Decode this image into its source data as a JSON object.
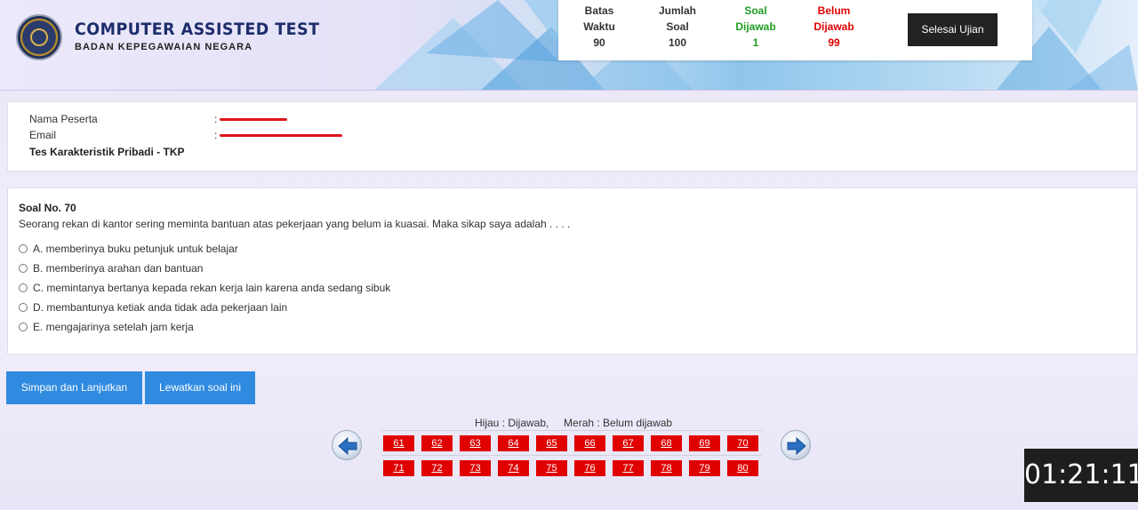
{
  "brand": {
    "title": "COMPUTER ASSISTED TEST",
    "subtitle": "BADAN KEPEGAWAIAN NEGARA"
  },
  "stats": {
    "batas_waktu": {
      "label1": "Batas",
      "label2": "Waktu",
      "value": "90"
    },
    "jumlah_soal": {
      "label1": "Jumlah",
      "label2": "Soal",
      "value": "100"
    },
    "soal_dijawab": {
      "label1": "Soal",
      "label2": "Dijawab",
      "value": "1"
    },
    "belum_dijawab": {
      "label1": "Belum",
      "label2": "Dijawab",
      "value": "99"
    }
  },
  "finish_button": "Selesai Ujian",
  "participant": {
    "name_label": "Nama Peserta",
    "email_label": "Email",
    "colon": ":",
    "test_name": "Tes Karakteristik Pribadi - TKP"
  },
  "question": {
    "number_label": "Soal No. 70",
    "text": "Seorang rekan di kantor sering meminta bantuan atas pekerjaan yang belum ia kuasai. Maka sikap saya adalah . . . .",
    "options": [
      "A. memberinya buku petunjuk untuk belajar",
      "B. memberinya arahan dan bantuan",
      "C. memintanya bertanya kepada rekan kerja lain karena anda sedang sibuk",
      "D. membantunya ketiak anda tidak ada pekerjaan lain",
      "E. mengajarinya setelah jam kerja"
    ]
  },
  "actions": {
    "save": "Simpan dan Lanjutkan",
    "skip": "Lewatkan soal ini"
  },
  "navigation": {
    "legend": "Hijau : Dijawab,     Merah : Belum dijawab",
    "row1": [
      "61",
      "62",
      "63",
      "64",
      "65",
      "66",
      "67",
      "68",
      "69",
      "70"
    ],
    "row2": [
      "71",
      "72",
      "73",
      "74",
      "75",
      "76",
      "77",
      "78",
      "79",
      "80"
    ]
  },
  "colors": {
    "answered": "#1f9d22",
    "unanswered": "#e00000",
    "button_blue": "#2f8ae0"
  },
  "timer": "01:21:11"
}
